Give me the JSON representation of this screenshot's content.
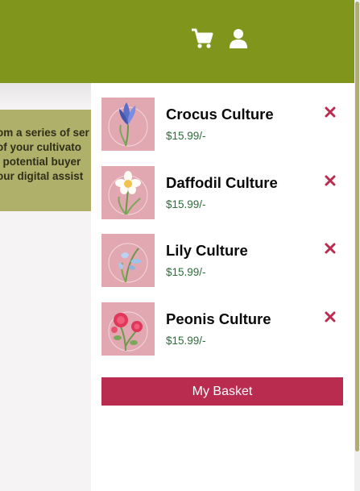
{
  "header": {
    "cart_icon": "cart-icon",
    "user_icon": "user-icon",
    "bg_color": "#80951b"
  },
  "banner": {
    "lines": [
      "om a series of ser",
      " of your cultivato",
      ", potential buyer",
      "our digital assist"
    ]
  },
  "basket": {
    "items": [
      {
        "name": "Crocus Culture",
        "price": "$15.99/-",
        "image": "crocus-image"
      },
      {
        "name": "Daffodil Culture",
        "price": "$15.99/-",
        "image": "daffodil-image"
      },
      {
        "name": "Lily Culture",
        "price": "$15.99/-",
        "image": "lily-image"
      },
      {
        "name": "Peonis Culture",
        "price": "$15.99/-",
        "image": "peony-image"
      }
    ],
    "remove_icon": "close-icon",
    "button_label": "My Basket",
    "accent_color": "#b92c4f"
  }
}
